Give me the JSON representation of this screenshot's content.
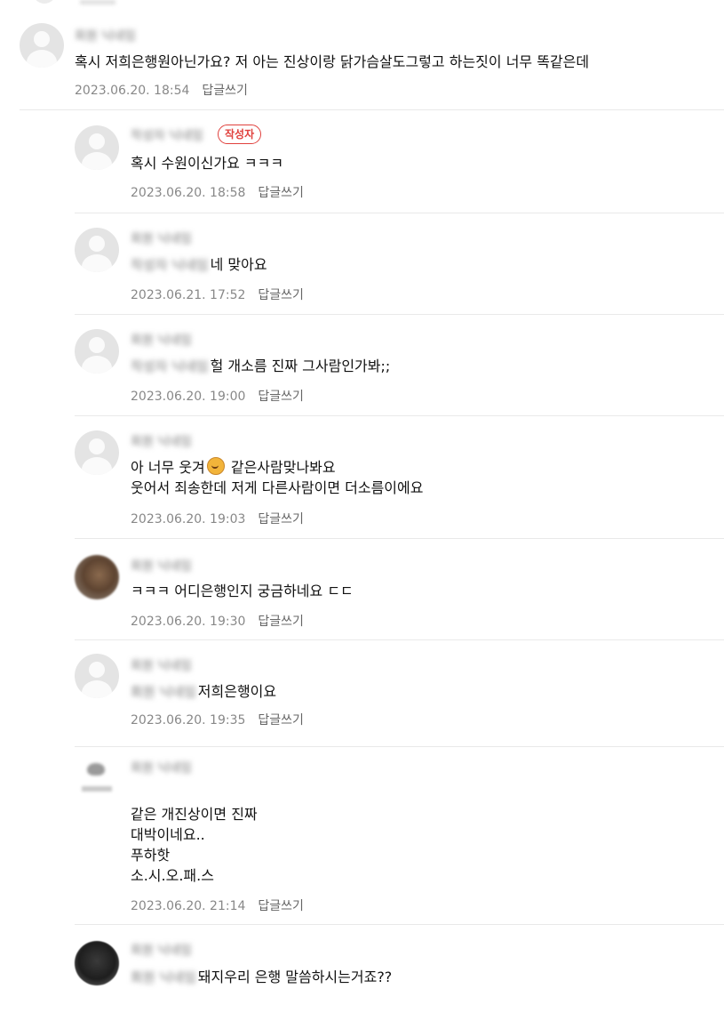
{
  "comments": [
    {
      "nickname": "회원 닉네임",
      "badge": "",
      "mention": "",
      "text": "혹시 저희은행원아닌가요? 저 아는 진상이랑 닭가슴살도그렇고 하는짓이 너무 똑같은데",
      "date": "2023.06.20. 18:54",
      "reply_label": "답글쓰기"
    },
    {
      "nickname": "작성자 닉네임",
      "badge": "작성자",
      "mention": "",
      "text": "혹시 수원이신가요 ㅋㅋㅋ",
      "date": "2023.06.20. 18:58",
      "reply_label": "답글쓰기"
    },
    {
      "nickname": "회원 닉네임",
      "badge": "",
      "mention": "작성자 닉네임",
      "text": "네 맞아요",
      "date": "2023.06.21. 17:52",
      "reply_label": "답글쓰기"
    },
    {
      "nickname": "회원 닉네임",
      "badge": "",
      "mention": "작성자 닉네임",
      "text": "헐 개소름 진짜 그사람인가봐;;",
      "date": "2023.06.20. 19:00",
      "reply_label": "답글쓰기"
    },
    {
      "nickname": "회원 닉네임",
      "badge": "",
      "mention": "",
      "text_before_emoji": "아 너무 웃겨",
      "emoji": "laughing-emoji",
      "text_after_emoji": " 같은사람맞나봐요",
      "text_line2": "웃어서 죄송한데 저게 다른사람이면 더소름이에요",
      "date": "2023.06.20. 19:03",
      "reply_label": "답글쓰기"
    },
    {
      "nickname": "회원 닉네임",
      "badge": "",
      "mention": "",
      "text": "ㅋㅋㅋ 어디은행인지 궁금하네요 ㄷㄷ",
      "date": "2023.06.20. 19:30",
      "reply_label": "답글쓰기"
    },
    {
      "nickname": "회원 닉네임",
      "badge": "",
      "mention": "회원 닉네임",
      "text": "저희은행이요",
      "date": "2023.06.20. 19:35",
      "reply_label": "답글쓰기"
    },
    {
      "nickname": "회원 닉네임",
      "badge": "",
      "mention": "",
      "text": "같은 개진상이면 진짜\n대박이네요..\n푸하핫\n소.시.오.패.스",
      "date": "2023.06.20. 21:14",
      "reply_label": "답글쓰기"
    },
    {
      "nickname": "회원 닉네임",
      "badge": "",
      "mention": "회원 닉네임",
      "text": "돼지우리 은행 말씀하시는거죠??",
      "date": "",
      "reply_label": ""
    }
  ]
}
